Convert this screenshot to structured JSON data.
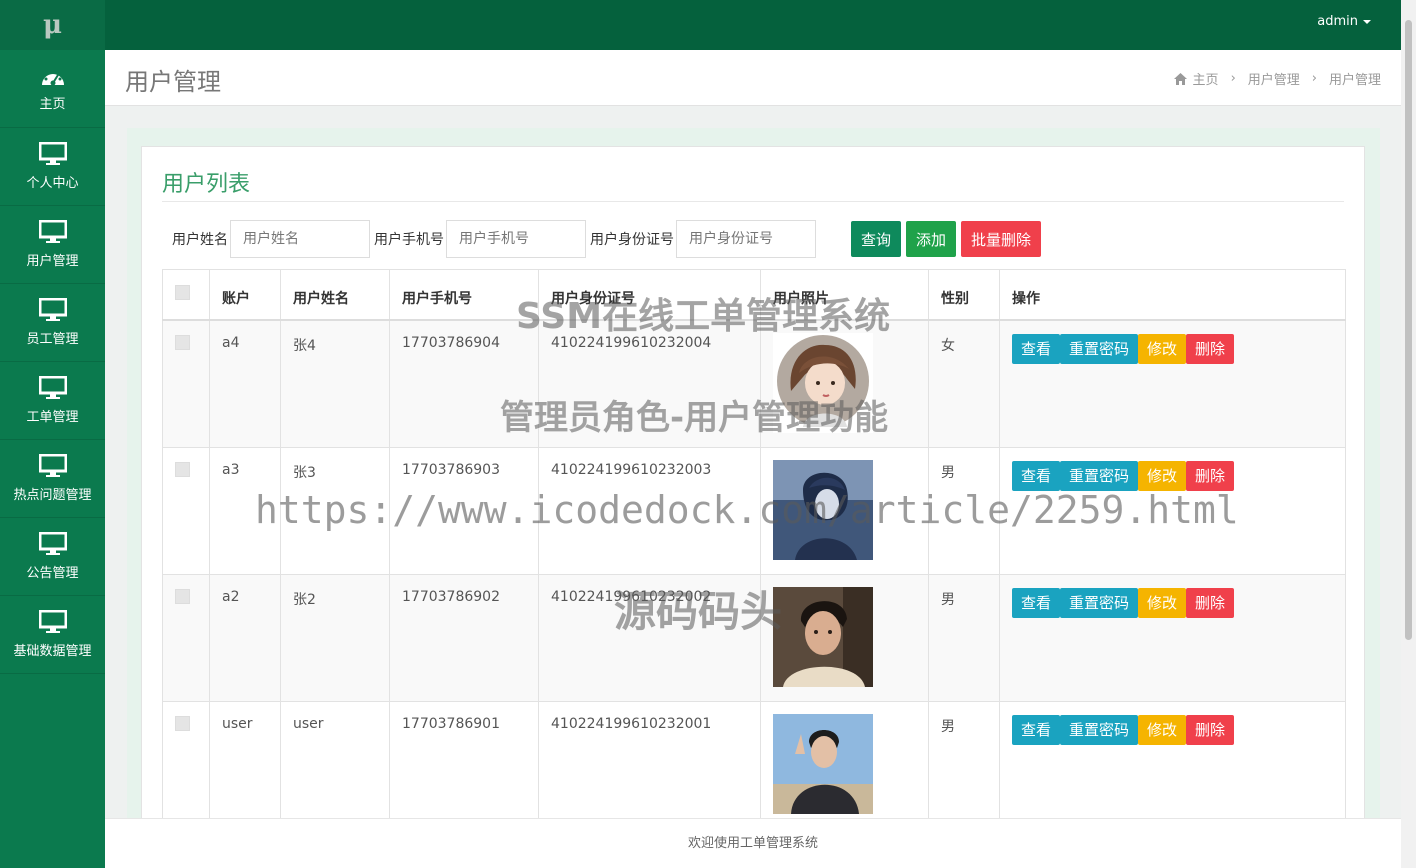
{
  "app": {
    "logo": "μ",
    "user_menu": "admin"
  },
  "sidebar": {
    "items": [
      {
        "label": "主页",
        "icon": "dashboard-icon"
      },
      {
        "label": "个人中心",
        "icon": "monitor-icon"
      },
      {
        "label": "用户管理",
        "icon": "monitor-icon"
      },
      {
        "label": "员工管理",
        "icon": "monitor-icon"
      },
      {
        "label": "工单管理",
        "icon": "monitor-icon"
      },
      {
        "label": "热点问题管理",
        "icon": "monitor-icon"
      },
      {
        "label": "公告管理",
        "icon": "monitor-icon"
      },
      {
        "label": "基础数据管理",
        "icon": "monitor-icon"
      }
    ]
  },
  "header": {
    "title": "用户管理",
    "breadcrumb": [
      "主页",
      "用户管理",
      "用户管理"
    ]
  },
  "panel": {
    "title": "用户列表",
    "search": {
      "fields": [
        {
          "label": "用户姓名",
          "placeholder": "用户姓名"
        },
        {
          "label": "用户手机号",
          "placeholder": "用户手机号"
        },
        {
          "label": "用户身份证号",
          "placeholder": "用户身份证号"
        }
      ],
      "query_label": "查询",
      "add_label": "添加",
      "batch_delete_label": "批量删除"
    },
    "table": {
      "columns": [
        "",
        "账户",
        "用户姓名",
        "用户手机号",
        "用户身份证号",
        "用户照片",
        "性别",
        "操作"
      ],
      "rows": [
        {
          "account": "a4",
          "name": "张4",
          "phone": "17703786904",
          "idcard": "410224199610232004",
          "gender": "女"
        },
        {
          "account": "a3",
          "name": "张3",
          "phone": "17703786903",
          "idcard": "410224199610232003",
          "gender": "男"
        },
        {
          "account": "a2",
          "name": "张2",
          "phone": "17703786902",
          "idcard": "410224199610232002",
          "gender": "男"
        },
        {
          "account": "user",
          "name": "user",
          "phone": "17703786901",
          "idcard": "410224199610232001",
          "gender": "男"
        }
      ],
      "actions": {
        "view": "查看",
        "reset": "重置密码",
        "edit": "修改",
        "delete": "删除"
      }
    }
  },
  "footer": {
    "text": "欢迎使用工单管理系统"
  },
  "watermarks": [
    "SSM在线工单管理系统",
    "管理员角色-用户管理功能",
    "https://www.icodedock.com/article/2259.html",
    "源码码头"
  ],
  "colors": {
    "sidebar": "#0b7a4e",
    "topbar": "#05613d",
    "accent": "#3a9e6a",
    "danger": "#f0404b",
    "info": "#1aa3c0",
    "warning": "#f5b400"
  }
}
